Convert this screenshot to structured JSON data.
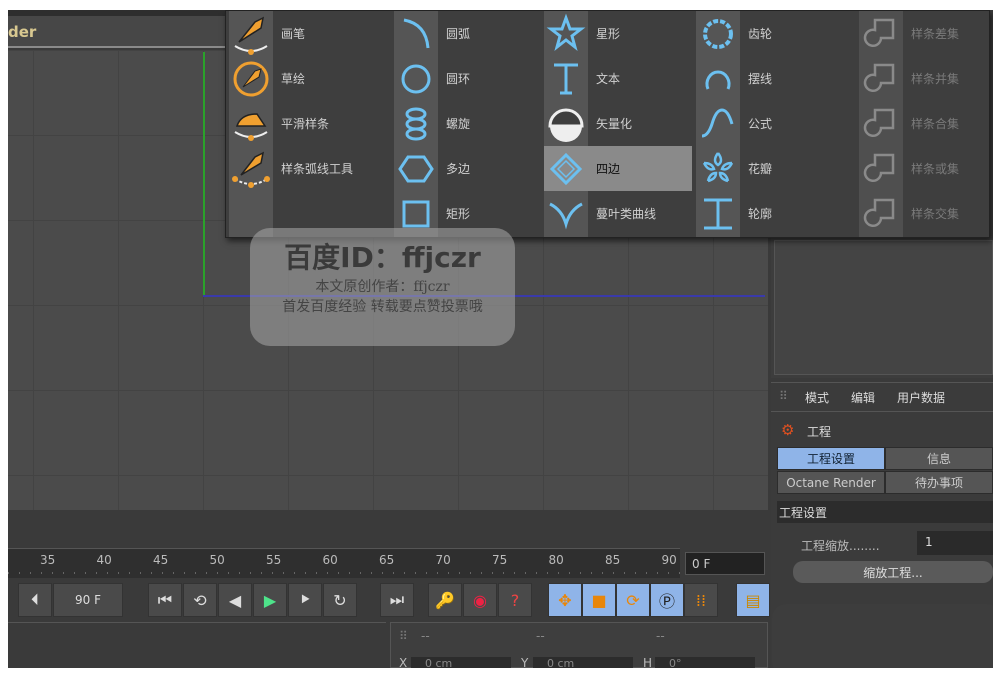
{
  "viewport": {
    "title_fragment": "der"
  },
  "menu": {
    "columns": [
      [
        {
          "label": "画笔",
          "icon": "pen-icon"
        },
        {
          "label": "草绘",
          "icon": "sketch-icon"
        },
        {
          "label": "平滑样条",
          "icon": "smooth-spline-icon"
        },
        {
          "label": "样条弧线工具",
          "icon": "spline-arc-icon"
        }
      ],
      [
        {
          "label": "圆弧",
          "icon": "arc-icon"
        },
        {
          "label": "圆环",
          "icon": "circle-icon"
        },
        {
          "label": "螺旋",
          "icon": "helix-icon"
        },
        {
          "label": "多边",
          "icon": "polygon-icon"
        },
        {
          "label": "矩形",
          "icon": "rectangle-icon"
        }
      ],
      [
        {
          "label": "星形",
          "icon": "star-icon"
        },
        {
          "label": "文本",
          "icon": "text-icon"
        },
        {
          "label": "矢量化",
          "icon": "vectorizer-icon"
        },
        {
          "label": "四边",
          "icon": "diamond-icon",
          "selected": true
        },
        {
          "label": "蔓叶类曲线",
          "icon": "cissoid-icon"
        }
      ],
      [
        {
          "label": "齿轮",
          "icon": "gear-icon"
        },
        {
          "label": "摆线",
          "icon": "cycloid-icon"
        },
        {
          "label": "公式",
          "icon": "formula-icon"
        },
        {
          "label": "花瓣",
          "icon": "flower-icon"
        },
        {
          "label": "轮廓",
          "icon": "profile-icon"
        }
      ],
      [
        {
          "label": "样条差集",
          "icon": "spline-subtract-icon"
        },
        {
          "label": "样条并集",
          "icon": "spline-union-icon"
        },
        {
          "label": "样条合集",
          "icon": "spline-and-icon"
        },
        {
          "label": "样条或集",
          "icon": "spline-or-icon"
        },
        {
          "label": "样条交集",
          "icon": "spline-intersect-icon"
        }
      ]
    ]
  },
  "timeline": {
    "ticks": [
      "35",
      "40",
      "45",
      "50",
      "55",
      "60",
      "65",
      "70",
      "75",
      "80",
      "85",
      "90"
    ],
    "current_frame": "0 F",
    "end_field": "90 F"
  },
  "coords": {
    "headers": [
      "--",
      "--",
      "--"
    ],
    "x": "0 cm",
    "y": "0 cm",
    "h": "0°",
    "x_label": "X",
    "y_label": "Y",
    "h_label": "H"
  },
  "attributes": {
    "menu": [
      "模式",
      "编辑",
      "用户数据"
    ],
    "object_title": "工程",
    "tabs": [
      "工程设置",
      "信息",
      "Octane Render",
      "待办事项"
    ],
    "section": "工程设置",
    "scale_label": "工程缩放........",
    "scale_value": "1",
    "scale_button": "缩放工程..."
  },
  "watermark": {
    "line1": "百度ID：ffjczr",
    "line2": "本文原创作者：ffjczr",
    "line3": "首发百度经验 转载要点赞投票哦"
  },
  "colors": {
    "accent_blue": "#8fb4e8",
    "icon_blue": "#6cc0f0",
    "icon_orange": "#f0a030",
    "selected": "#8a8a8a"
  }
}
